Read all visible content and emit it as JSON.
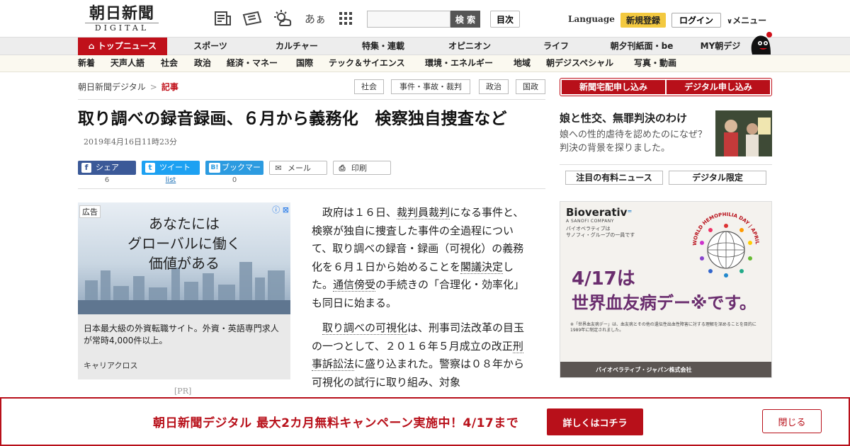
{
  "header": {
    "logo_main": "朝日新聞",
    "logo_sub": "DIGITAL",
    "hiragana_icon_text": "あぁ",
    "search": {
      "placeholder": "",
      "button_label": "検 索"
    },
    "toc_label": "目次",
    "language_label": "Language",
    "register_label": "新規登録",
    "login_label": "ログイン",
    "menu_label": "メニュー"
  },
  "nav_primary": [
    {
      "label": "トップニュース"
    },
    {
      "label": "スポーツ"
    },
    {
      "label": "カルチャー"
    },
    {
      "label": "特集・連載"
    },
    {
      "label": "オピニオン"
    },
    {
      "label": "ライフ"
    },
    {
      "label": "朝夕刊紙面・be"
    },
    {
      "label": "MY朝デジ"
    }
  ],
  "nav_secondary": [
    {
      "label": "新着"
    },
    {
      "label": "天声人語"
    },
    {
      "label": "社会"
    },
    {
      "label": "政治"
    },
    {
      "label": "経済・マネー"
    },
    {
      "label": "国際"
    },
    {
      "label": "テック＆サイエンス"
    },
    {
      "label": "環境・エネルギー"
    },
    {
      "label": "地域"
    },
    {
      "label": "朝デジスペシャル"
    },
    {
      "label": "写真・動画"
    }
  ],
  "breadcrumb": {
    "home": "朝日新聞デジタル",
    "separator": ">",
    "current": "記事"
  },
  "tags": [
    {
      "label": "社会"
    },
    {
      "label": "事件・事故・裁判"
    },
    {
      "label": "政治"
    },
    {
      "label": "国政"
    }
  ],
  "article": {
    "headline": "取り調べの録音録画、６月から義務化　検察独自捜査など",
    "date": "2019年4月16日11時23分",
    "p1": {
      "a": "政府は１６日、",
      "k1": "裁判員裁判",
      "b": "になる事件と、検察が独自に捜査した事件の全過程について、取り調べの録音・録画（可視化）の義務化を６月１日から始めることを",
      "k2": "閣議決定",
      "c": "した。",
      "k3": "通信傍受",
      "d": "の手続きの「合理化・効率化」も同日に始まる。"
    },
    "p2": {
      "k1": "取り調べの可視化",
      "a": "は、刑事司法改革の目玉の一つとして、２０１６年５月成立の改正",
      "k2": "刑事訴訟法",
      "b": "に盛り込まれた。警察は０８年から可視化の試行に取り組み、対象"
    }
  },
  "share": {
    "facebook": {
      "label": "シェア",
      "count": "6",
      "icon": "f"
    },
    "twitter": {
      "label": "ツイート",
      "count": "list",
      "icon": "t"
    },
    "hatena": {
      "label": "ブックマーク",
      "count": "0",
      "icon": "B!"
    },
    "mail": {
      "label": "メール"
    },
    "print": {
      "label": "印刷"
    }
  },
  "ad_left": {
    "label": "広告",
    "headline_lines": [
      "あなたには",
      "グローバルに働く",
      "価値がある"
    ],
    "body": "日本最大級の外資転職サイト。外資・英語専門求人が常時4,000件以上。",
    "brand": "キャリアクロス",
    "pr": "[PR]"
  },
  "sidebar": {
    "subscribe_paper": "新聞宅配申し込み",
    "subscribe_digital": "デジタル申し込み",
    "feature": {
      "title": "娘と性交、無罪判決のわけ",
      "desc": "娘への性的虐待を認めたのになぜ？　判決の背景を探りました。"
    },
    "tabs": [
      {
        "label": "注目の有料ニュース"
      },
      {
        "label": "デジタル限定"
      }
    ]
  },
  "ad_right": {
    "brand": "Bioverativ",
    "brand_sub": "A SANOFI COMPANY",
    "note_line1": "バイオベラティブは",
    "note_line2": "サノフィ・グループの一員です",
    "globe_label": "WORLD HEMOPHILIA DAY | APRIL 17",
    "main_line1": "4/17は",
    "main_line2": "世界血友病デー※です。",
    "footnote": "※「世界血友病デー」は、血友病とその他の遺伝性出血性障害に対する理解を深めることを目的に1989年に制定されました。",
    "footer": "バイオベラティブ・ジャパン株式会社　https://www.bioverativ.co.jp"
  },
  "banner": {
    "text": "朝日新聞デジタル 最大2カ月無料キャンペーン実施中！4/17まで",
    "cta": "詳しくはコチラ",
    "close": "閉じる"
  },
  "colors": {
    "brand_red": "#c0101a",
    "facebook": "#3b5998",
    "twitter": "#1da1f2",
    "hatena": "#2c9be0",
    "register_yellow": "#f3c940"
  }
}
